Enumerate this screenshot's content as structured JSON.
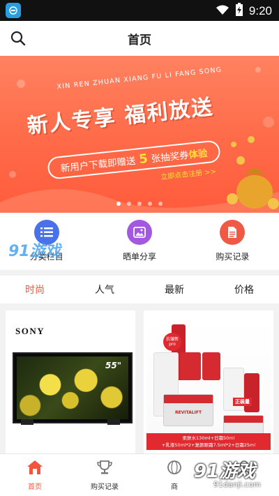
{
  "status_bar": {
    "time": "9:20"
  },
  "header": {
    "title": "首页"
  },
  "banner": {
    "pinyin": "XIN REN ZHUAN XIANG FU LI FANG SONG",
    "title": "新人专享 福利放送",
    "pill_prefix": "新用户下载即赠送",
    "pill_number": "5",
    "pill_mid": "张抽奖券",
    "pill_accent": "体验",
    "register": "立即点击注册 >>",
    "dots_count": 5,
    "active_dot": 0
  },
  "quick_links": [
    {
      "label": "分类栏目",
      "icon": "list-icon",
      "color": "#4a72e8"
    },
    {
      "label": "晒单分享",
      "icon": "image-icon",
      "color": "#a358e0"
    },
    {
      "label": "购买记录",
      "icon": "document-icon",
      "color": "#f05a45"
    }
  ],
  "tabs": [
    {
      "label": "时尚",
      "active": true
    },
    {
      "label": "人气",
      "active": false
    },
    {
      "label": "最新",
      "active": false
    },
    {
      "label": "价格",
      "active": false
    }
  ],
  "products": {
    "left": {
      "brand": "SONY",
      "size_label": "55\""
    },
    "right": {
      "badge": "抗皱新pro",
      "tag": "正装量",
      "product_label": "REVITALIFT",
      "caption_line1": "柔肤水130ml+日霜50ml",
      "caption_line2": "+乳液50ml*2+复颜眼霜7.5ml*2+日霜25ml"
    }
  },
  "bottom_nav": [
    {
      "label": "首页",
      "icon": "home-icon",
      "active": true
    },
    {
      "label": "购买记录",
      "icon": "trophy-icon",
      "active": false
    },
    {
      "label": "商",
      "icon": "globe-icon",
      "active": false
    }
  ],
  "watermark": {
    "brand": "91游戏",
    "domain": "91danji.com"
  },
  "colors": {
    "accent": "#f2543c",
    "banner": "#ff6a48"
  }
}
